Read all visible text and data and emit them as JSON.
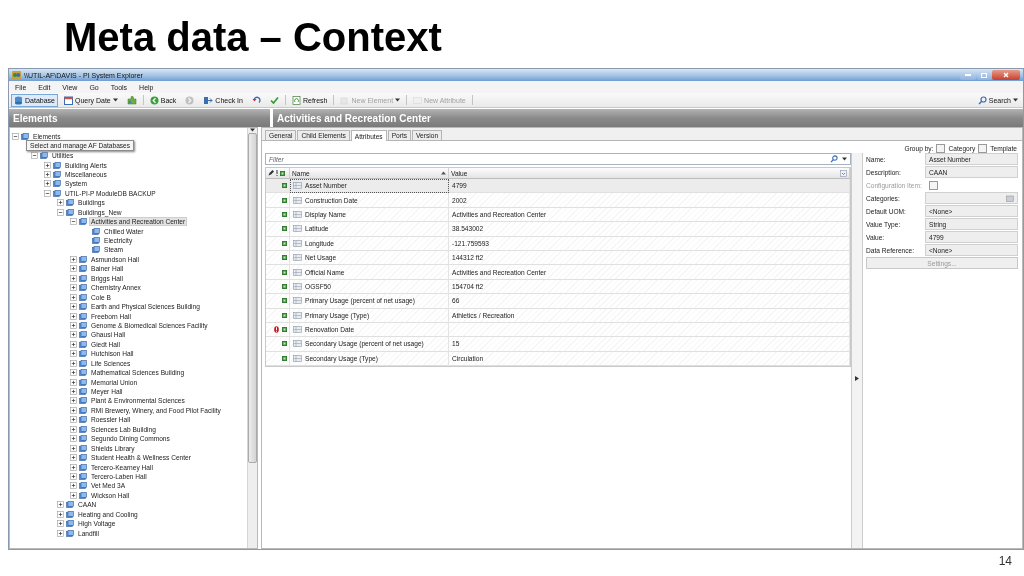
{
  "slide": {
    "title": "Meta data – Context",
    "page_number": "14"
  },
  "window": {
    "title": "\\\\UTIL-AF\\DAVIS - PI System Explorer"
  },
  "menu": [
    "File",
    "Edit",
    "View",
    "Go",
    "Tools",
    "Help"
  ],
  "toolbar": [
    {
      "kind": "text",
      "label": "Database",
      "selected": true,
      "disabled": false
    },
    {
      "kind": "text",
      "label": "Query Date",
      "selected": false,
      "disabled": false,
      "dropdown": true
    },
    {
      "kind": "icon",
      "selected": false,
      "disabled": false
    },
    {
      "kind": "text",
      "label": "Back",
      "selected": false,
      "disabled": false
    },
    {
      "kind": "icon",
      "selected": false,
      "disabled": true
    },
    {
      "kind": "text",
      "label": "Check In",
      "selected": false,
      "disabled": false
    },
    {
      "kind": "icon",
      "selected": false,
      "disabled": false
    },
    {
      "kind": "icon",
      "selected": false,
      "disabled": false
    },
    {
      "kind": "text",
      "label": "Refresh",
      "selected": false,
      "disabled": false
    },
    {
      "kind": "text",
      "label": "New Element",
      "selected": false,
      "disabled": true,
      "dropdown": true
    },
    {
      "kind": "text",
      "label": "New Attribute",
      "selected": false,
      "disabled": true
    }
  ],
  "search": {
    "label": "Search"
  },
  "left_header": "Elements",
  "right_header": "Activities and Recreation Center",
  "tree": {
    "tooltip": "Select and manage AF Databases",
    "items": [
      {
        "label": "Elements",
        "expanded": true,
        "selected": false,
        "children": [
          {
            "label": "Utilities",
            "expanded": true,
            "selected": false,
            "children": [
              {
                "label": "Building Alerts",
                "expanded": false,
                "selected": false
              },
              {
                "label": "Miscellaneous",
                "expanded": false,
                "selected": false
              },
              {
                "label": "System",
                "expanded": false,
                "selected": false
              },
              {
                "label": "UTIL-PI-P ModuleDB BACKUP",
                "expanded": true,
                "selected": false,
                "children": [
                  {
                    "label": "Buildings",
                    "expanded": false,
                    "selected": false
                  },
                  {
                    "label": "Buildings_New",
                    "expanded": true,
                    "selected": false,
                    "children": [
                      {
                        "label": "Activities and Recreation Center",
                        "expanded": true,
                        "selected": true,
                        "children": [
                          {
                            "label": "Chilled Water",
                            "selected": false
                          },
                          {
                            "label": "Electricity",
                            "selected": false
                          },
                          {
                            "label": "Steam",
                            "selected": false
                          }
                        ]
                      },
                      {
                        "label": "Asmundson Hall",
                        "expanded": false,
                        "selected": false
                      },
                      {
                        "label": "Bainer Hall",
                        "expanded": false,
                        "selected": false
                      },
                      {
                        "label": "Briggs Hall",
                        "expanded": false,
                        "selected": false
                      },
                      {
                        "label": "Chemistry Annex",
                        "expanded": false,
                        "selected": false
                      },
                      {
                        "label": "Cole B",
                        "expanded": false,
                        "selected": false
                      },
                      {
                        "label": "Earth and Physical Sciences Building",
                        "expanded": false,
                        "selected": false
                      },
                      {
                        "label": "Freeborn Hall",
                        "expanded": false,
                        "selected": false
                      },
                      {
                        "label": "Genome & Biomedical Sciences Facility",
                        "expanded": false,
                        "selected": false
                      },
                      {
                        "label": "Ghausi Hall",
                        "expanded": false,
                        "selected": false
                      },
                      {
                        "label": "Giedt Hall",
                        "expanded": false,
                        "selected": false
                      },
                      {
                        "label": "Hutchison Hall",
                        "expanded": false,
                        "selected": false
                      },
                      {
                        "label": "Life Sciences",
                        "expanded": false,
                        "selected": false
                      },
                      {
                        "label": "Mathematical Sciences Building",
                        "expanded": false,
                        "selected": false
                      },
                      {
                        "label": "Memorial Union",
                        "expanded": false,
                        "selected": false
                      },
                      {
                        "label": "Meyer Hall",
                        "expanded": false,
                        "selected": false
                      },
                      {
                        "label": "Plant & Environmental Sciences",
                        "expanded": false,
                        "selected": false
                      },
                      {
                        "label": "RMI Brewery, Winery, and Food Pilot Facility",
                        "expanded": false,
                        "selected": false
                      },
                      {
                        "label": "Roessler Hall",
                        "expanded": false,
                        "selected": false
                      },
                      {
                        "label": "Sciences Lab Building",
                        "expanded": false,
                        "selected": false
                      },
                      {
                        "label": "Segundo Dining Commons",
                        "expanded": false,
                        "selected": false
                      },
                      {
                        "label": "Shields Library",
                        "expanded": false,
                        "selected": false
                      },
                      {
                        "label": "Student Health & Wellness Center",
                        "expanded": false,
                        "selected": false
                      },
                      {
                        "label": "Tercero-Kearney Hall",
                        "expanded": false,
                        "selected": false
                      },
                      {
                        "label": "Tercero-Laben Hall",
                        "expanded": false,
                        "selected": false
                      },
                      {
                        "label": "Vet Med 3A",
                        "expanded": false,
                        "selected": false
                      },
                      {
                        "label": "Wickson Hall",
                        "expanded": false,
                        "selected": false
                      }
                    ]
                  },
                  {
                    "label": "CAAN",
                    "expanded": false,
                    "selected": false
                  },
                  {
                    "label": "Heating and Cooling",
                    "expanded": false,
                    "selected": false
                  },
                  {
                    "label": "High Voltage",
                    "expanded": false,
                    "selected": false
                  },
                  {
                    "label": "Landfill",
                    "expanded": false,
                    "selected": false
                  }
                ]
              }
            ]
          }
        ]
      }
    ]
  },
  "tabs": [
    {
      "label": "General",
      "selected": false
    },
    {
      "label": "Child Elements",
      "selected": false
    },
    {
      "label": "Attributes",
      "selected": true
    },
    {
      "label": "Ports",
      "selected": false
    },
    {
      "label": "Version",
      "selected": false
    }
  ],
  "group_by": {
    "label": "Group by:",
    "options": [
      {
        "label": "Category",
        "checked": false
      },
      {
        "label": "Template",
        "checked": false
      }
    ]
  },
  "filter": {
    "placeholder": "Filter"
  },
  "attributes": {
    "columns": [
      "Name",
      "Value"
    ],
    "rows": [
      {
        "name": "Asset Number",
        "value": "4799",
        "selected": true,
        "error": false
      },
      {
        "name": "Construction Date",
        "value": "2002",
        "selected": false,
        "error": false
      },
      {
        "name": "Display Name",
        "value": "Activities and Recreation Center",
        "selected": false,
        "error": false
      },
      {
        "name": "Latitude",
        "value": "38.543002",
        "selected": false,
        "error": false
      },
      {
        "name": "Longitude",
        "value": "-121.759593",
        "selected": false,
        "error": false
      },
      {
        "name": "Net Usage",
        "value": "144312 ft2",
        "selected": false,
        "error": false
      },
      {
        "name": "Official Name",
        "value": "Activities and Recreation Center",
        "selected": false,
        "error": false
      },
      {
        "name": "OGSF50",
        "value": "154704 ft2",
        "selected": false,
        "error": false
      },
      {
        "name": "Primary Usage (percent of net usage)",
        "value": "66",
        "selected": false,
        "error": false
      },
      {
        "name": "Primary Usage (Type)",
        "value": "Athletics / Recreation",
        "selected": false,
        "error": false
      },
      {
        "name": "Renovation Date",
        "selected": false,
        "error": true
      },
      {
        "name": "Secondary Usage (percent of net usage)",
        "value": "15",
        "selected": false,
        "error": false
      },
      {
        "name": "Secondary Usage (Type)",
        "value": "Circulation",
        "selected": false,
        "error": false
      }
    ]
  },
  "properties": {
    "fields": [
      {
        "kind": "text",
        "label": "Name:",
        "value": "Asset Number",
        "disabled": false
      },
      {
        "kind": "text",
        "label": "Description:",
        "value": "CAAN",
        "disabled": false
      },
      {
        "kind": "checkbox",
        "label": "Configuration Item:",
        "checked": false,
        "disabled": true
      },
      {
        "kind": "picker",
        "label": "Categories:",
        "disabled": false
      },
      {
        "kind": "combo",
        "label": "Default UOM:",
        "value": "<None>",
        "disabled": false
      },
      {
        "kind": "combo",
        "label": "Value Type:",
        "value": "String",
        "disabled": false
      },
      {
        "kind": "text",
        "label": "Value:",
        "value": "4799",
        "disabled": false
      },
      {
        "kind": "combo",
        "label": "Data Reference:",
        "value": "<None>",
        "disabled": false
      }
    ],
    "button": {
      "label": "Settings...",
      "disabled": true
    }
  }
}
